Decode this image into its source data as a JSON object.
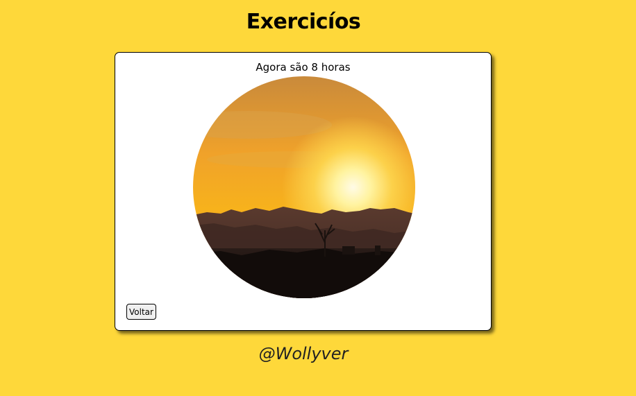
{
  "header": {
    "title": "Exercicíos"
  },
  "card": {
    "time_text": "Agora são 8 horas",
    "back_label": "Voltar"
  },
  "footer": {
    "credit": "@Wollyver"
  },
  "colors": {
    "background": "#fed83a",
    "card": "#ffffff"
  }
}
